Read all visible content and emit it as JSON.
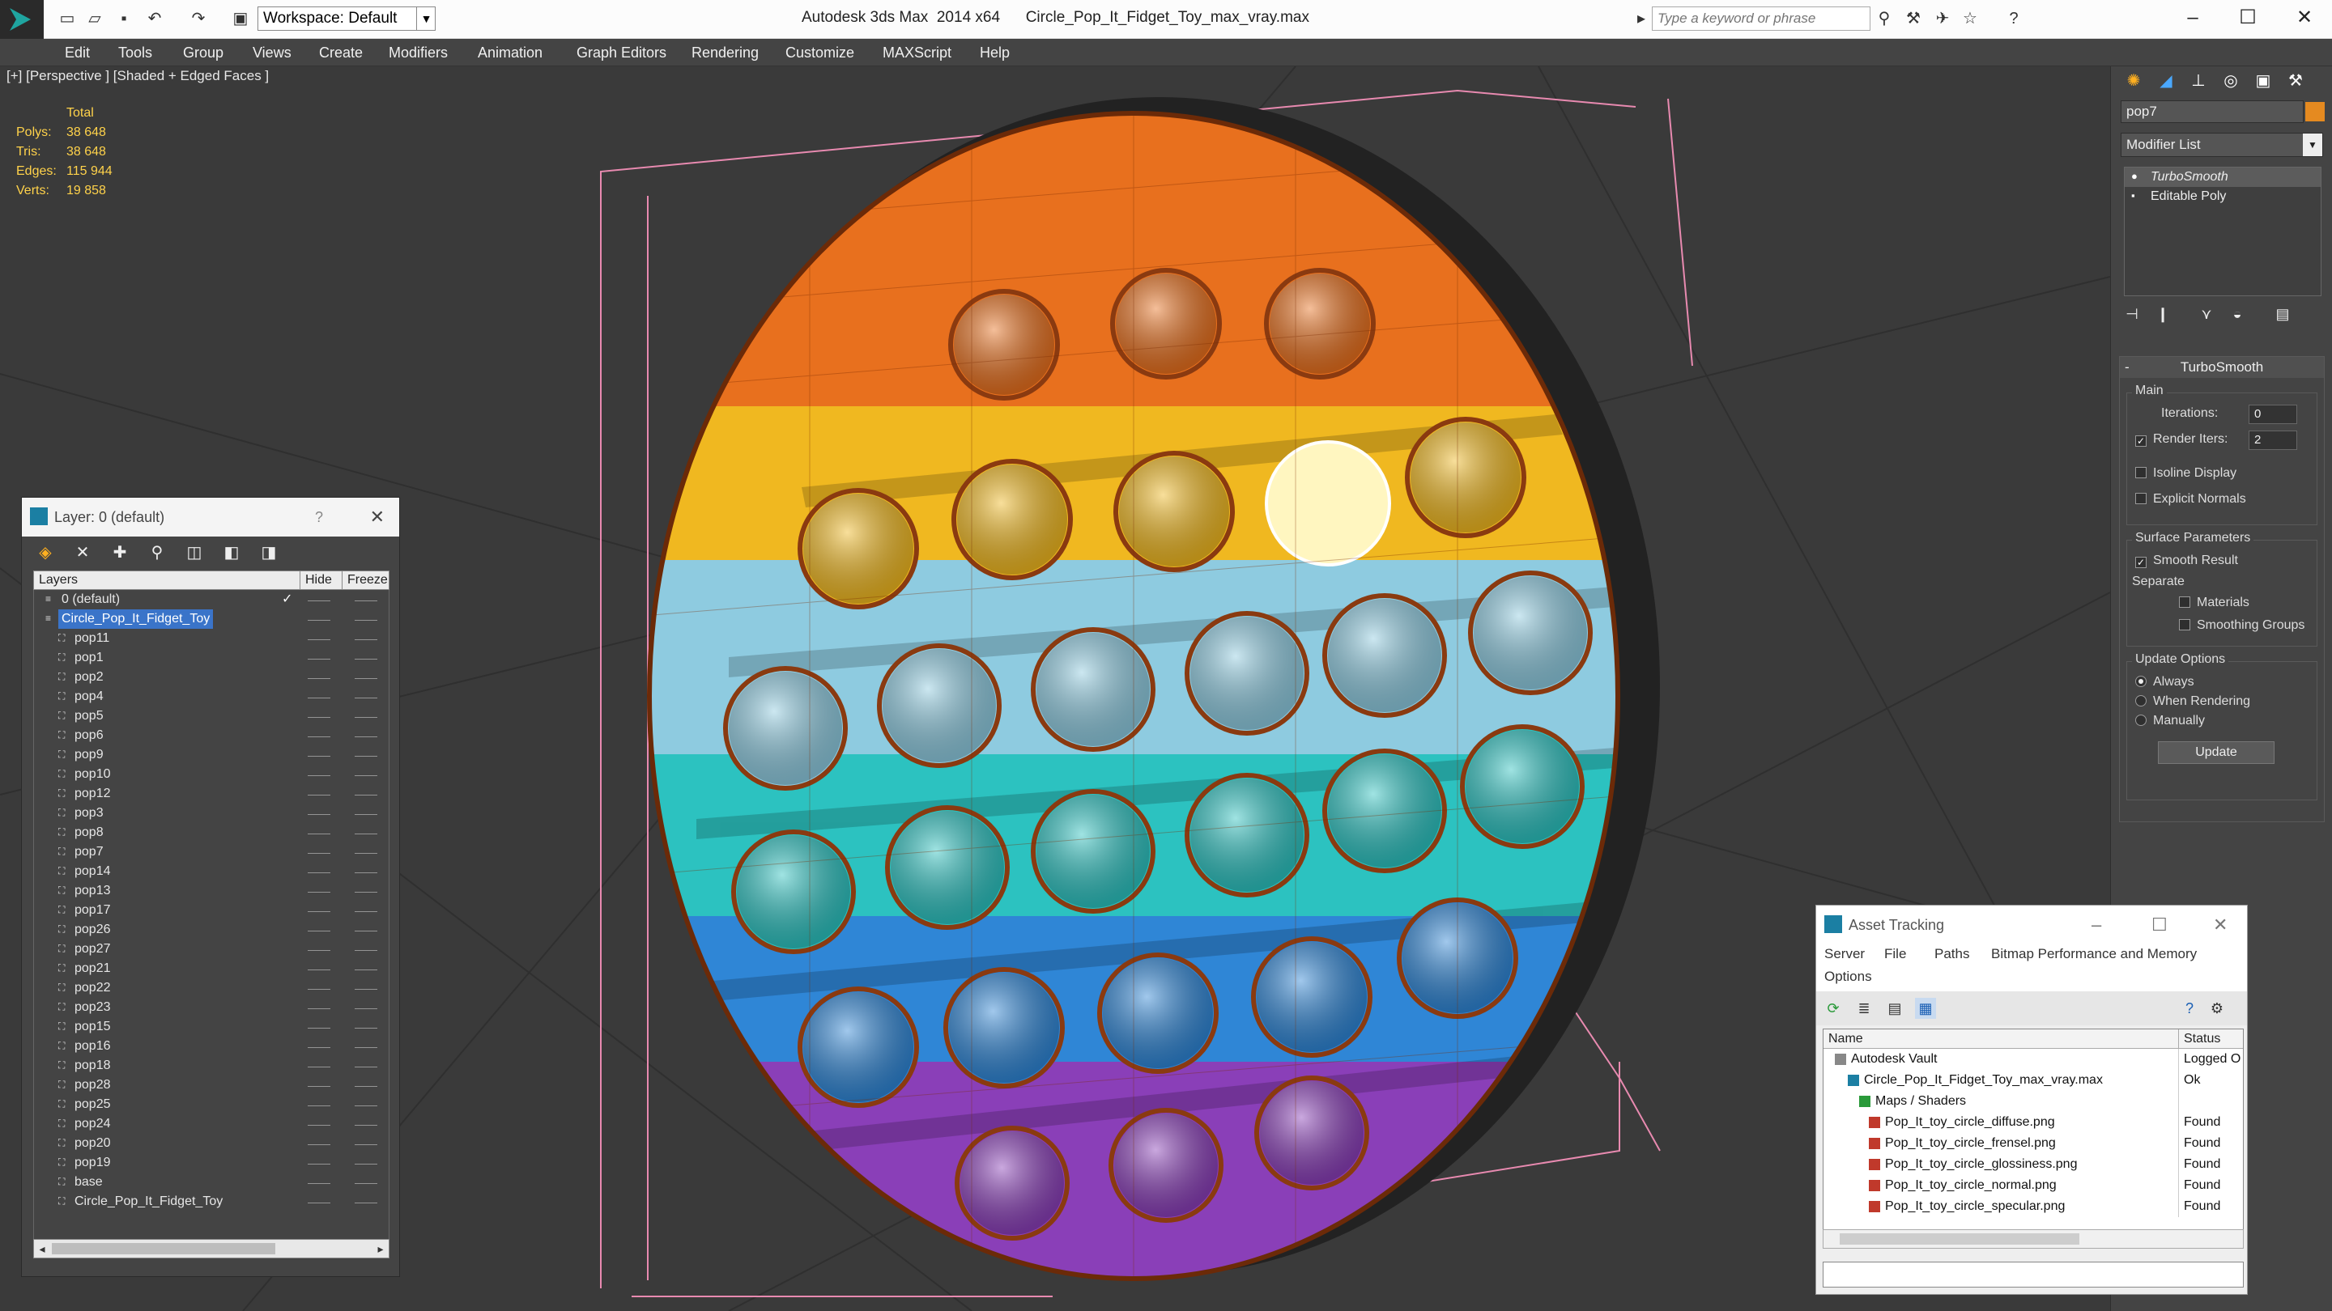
{
  "app": {
    "title": "Autodesk 3ds Max  2014 x64      Circle_Pop_It_Fidget_Toy_max_vray.max",
    "workspace": "Workspace: Default",
    "search_placeholder": "Type a keyword or phrase"
  },
  "menu": [
    "Edit",
    "Tools",
    "Group",
    "Views",
    "Create",
    "Modifiers",
    "Animation",
    "Graph Editors",
    "Rendering",
    "Customize",
    "MAXScript",
    "Help"
  ],
  "viewport": {
    "label": "[+] [Perspective ] [Shaded + Edged Faces ]",
    "stats": {
      "header": "Total",
      "rows": [
        {
          "k": "Polys:",
          "v": "38 648"
        },
        {
          "k": "Tris:",
          "v": "38 648"
        },
        {
          "k": "Edges:",
          "v": "115 944"
        },
        {
          "k": "Verts:",
          "v": "19 858"
        }
      ]
    }
  },
  "command_panel": {
    "object_name": "pop7",
    "modifier_list": "Modifier List",
    "stack": [
      "TurboSmooth",
      "Editable Poly"
    ],
    "rollout": "TurboSmooth",
    "main_group": "Main",
    "iterations_label": "Iterations:",
    "iterations_value": "0",
    "render_iters_label": "Render Iters:",
    "render_iters_value": "2",
    "isoline": "Isoline Display",
    "explicit_normals": "Explicit Normals",
    "surface_group": "Surface Parameters",
    "smooth_result": "Smooth Result",
    "separate": "Separate",
    "materials": "Materials",
    "smoothing_groups": "Smoothing Groups",
    "update_group": "Update Options",
    "always": "Always",
    "when_rendering": "When Rendering",
    "manually": "Manually",
    "update_button": "Update"
  },
  "layer_dialog": {
    "title": "Layer: 0 (default)",
    "help": "?",
    "col_layers": "Layers",
    "col_hide": "Hide",
    "col_freeze": "Freeze",
    "rows": [
      {
        "name": "0 (default)",
        "level": 0
      },
      {
        "name": "Circle_Pop_It_Fidget_Toy",
        "level": 0
      },
      {
        "name": "pop11",
        "level": 1
      },
      {
        "name": "pop1",
        "level": 1
      },
      {
        "name": "pop2",
        "level": 1
      },
      {
        "name": "pop4",
        "level": 1
      },
      {
        "name": "pop5",
        "level": 1
      },
      {
        "name": "pop6",
        "level": 1
      },
      {
        "name": "pop9",
        "level": 1
      },
      {
        "name": "pop10",
        "level": 1
      },
      {
        "name": "pop12",
        "level": 1
      },
      {
        "name": "pop3",
        "level": 1
      },
      {
        "name": "pop8",
        "level": 1
      },
      {
        "name": "pop7",
        "level": 1
      },
      {
        "name": "pop14",
        "level": 1
      },
      {
        "name": "pop13",
        "level": 1
      },
      {
        "name": "pop17",
        "level": 1
      },
      {
        "name": "pop26",
        "level": 1
      },
      {
        "name": "pop27",
        "level": 1
      },
      {
        "name": "pop21",
        "level": 1
      },
      {
        "name": "pop22",
        "level": 1
      },
      {
        "name": "pop23",
        "level": 1
      },
      {
        "name": "pop15",
        "level": 1
      },
      {
        "name": "pop16",
        "level": 1
      },
      {
        "name": "pop18",
        "level": 1
      },
      {
        "name": "pop28",
        "level": 1
      },
      {
        "name": "pop25",
        "level": 1
      },
      {
        "name": "pop24",
        "level": 1
      },
      {
        "name": "pop20",
        "level": 1
      },
      {
        "name": "pop19",
        "level": 1
      },
      {
        "name": "base",
        "level": 1
      },
      {
        "name": "Circle_Pop_It_Fidget_Toy",
        "level": 1
      }
    ]
  },
  "asset_dialog": {
    "title": "Asset Tracking",
    "menu": [
      "Server",
      "File",
      "Paths",
      "Bitmap Performance and Memory",
      "Options"
    ],
    "col_name": "Name",
    "col_status": "Status",
    "rows": [
      {
        "name": "Autodesk Vault",
        "status": "Logged O",
        "level": 0
      },
      {
        "name": "Circle_Pop_It_Fidget_Toy_max_vray.max",
        "status": "Ok",
        "level": 1
      },
      {
        "name": "Maps / Shaders",
        "status": "",
        "level": 2
      },
      {
        "name": "Pop_It_toy_circle_diffuse.png",
        "status": "Found",
        "level": 3
      },
      {
        "name": "Pop_It_toy_circle_frensel.png",
        "status": "Found",
        "level": 3
      },
      {
        "name": "Pop_It_toy_circle_glossiness.png",
        "status": "Found",
        "level": 3
      },
      {
        "name": "Pop_It_toy_circle_normal.png",
        "status": "Found",
        "level": 3
      },
      {
        "name": "Pop_It_toy_circle_specular.png",
        "status": "Found",
        "level": 3
      }
    ]
  },
  "colors": {
    "orange": "#e8701e",
    "yellow": "#f0b820",
    "light_blue": "#8ecbe0",
    "teal": "#2cc2c0",
    "blue": "#2f86d6",
    "purple": "#8a3fb8",
    "selection": "#3a74c9"
  }
}
